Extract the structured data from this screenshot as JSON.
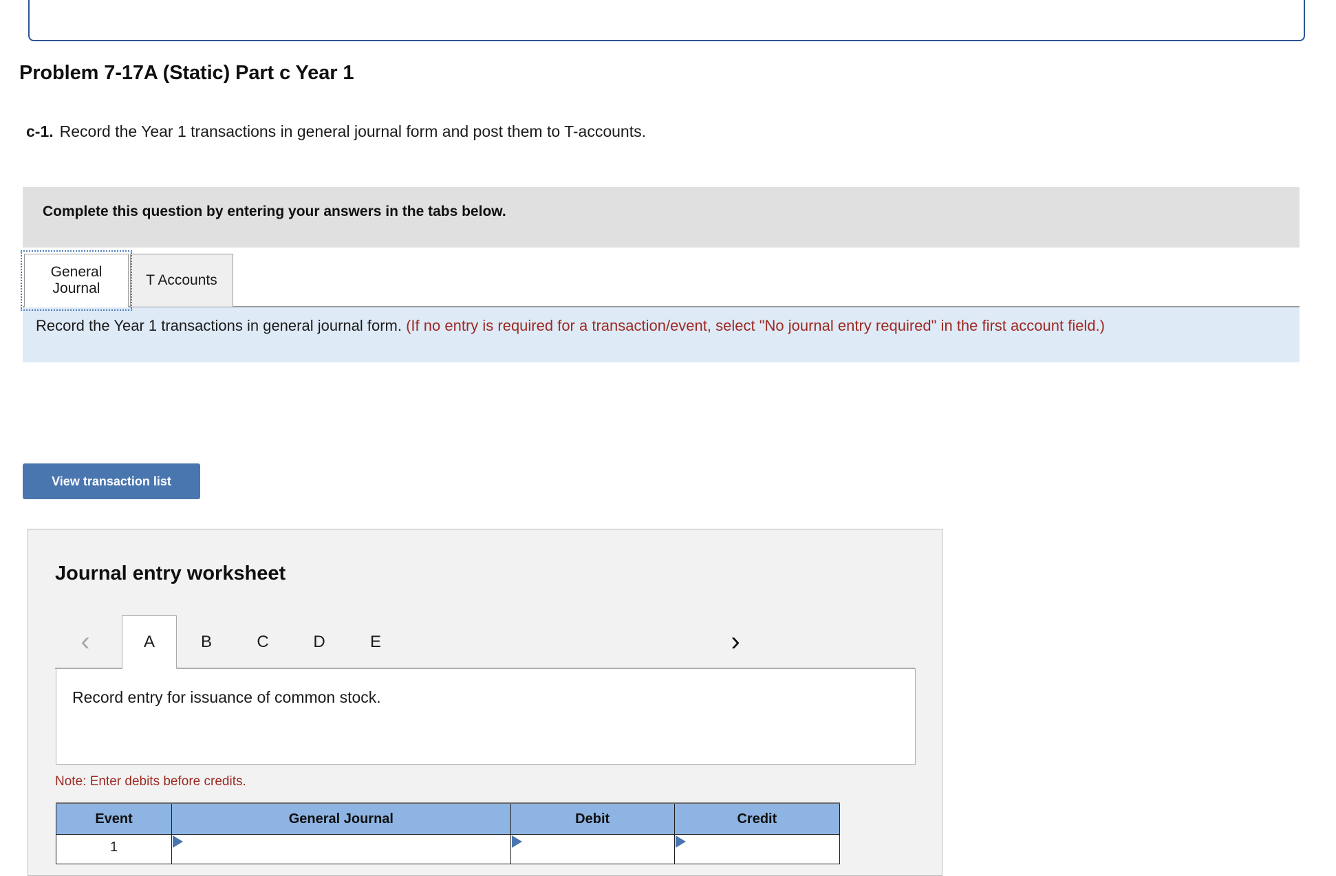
{
  "page_title": "Problem 7-17A (Static) Part c Year 1",
  "requirement": {
    "label": "c-1.",
    "text": "Record the Year 1 transactions in general journal form and post them to T-accounts."
  },
  "complete_bar": {
    "text": "Complete this question by entering your answers in the tabs below."
  },
  "tabs": [
    {
      "id": "general-journal",
      "label_line1": "General",
      "label_line2": "Journal",
      "active": true,
      "focused": true
    },
    {
      "id": "t-accounts",
      "label_line1": "T Accounts",
      "label_line2": "",
      "active": false,
      "focused": false
    }
  ],
  "instruction_banner": {
    "black_text": "Record the Year 1 transactions in general journal form.",
    "red_text": "(If no entry is required for a transaction/event, select \"No journal entry required\" in the first account field.)"
  },
  "buttons": {
    "view_transaction_list": "View transaction list"
  },
  "worksheet": {
    "title": "Journal entry worksheet",
    "prev_icon": "chevron-left-icon",
    "next_icon": "chevron-right-icon",
    "prev_glyph": "‹",
    "next_glyph": "›",
    "subtabs": [
      {
        "label": "A",
        "active": true
      },
      {
        "label": "B",
        "active": false
      },
      {
        "label": "C",
        "active": false
      },
      {
        "label": "D",
        "active": false
      },
      {
        "label": "E",
        "active": false
      }
    ],
    "description": "Record entry for issuance of common stock.",
    "note": "Note: Enter debits before credits.",
    "table": {
      "headers": [
        "Event",
        "General Journal",
        "Debit",
        "Credit"
      ],
      "rows": [
        {
          "event": "1",
          "general_journal": "",
          "debit": "",
          "credit": ""
        }
      ]
    }
  },
  "colors": {
    "accent_blue": "#4a76b0",
    "table_header_blue": "#8db4e2",
    "banner_blue": "#dfeaf7",
    "gray_bar": "#e0e0e0",
    "red_text": "#9c2a22",
    "panel_gray": "#f2f2f2",
    "top_border_blue": "#2d5693"
  }
}
